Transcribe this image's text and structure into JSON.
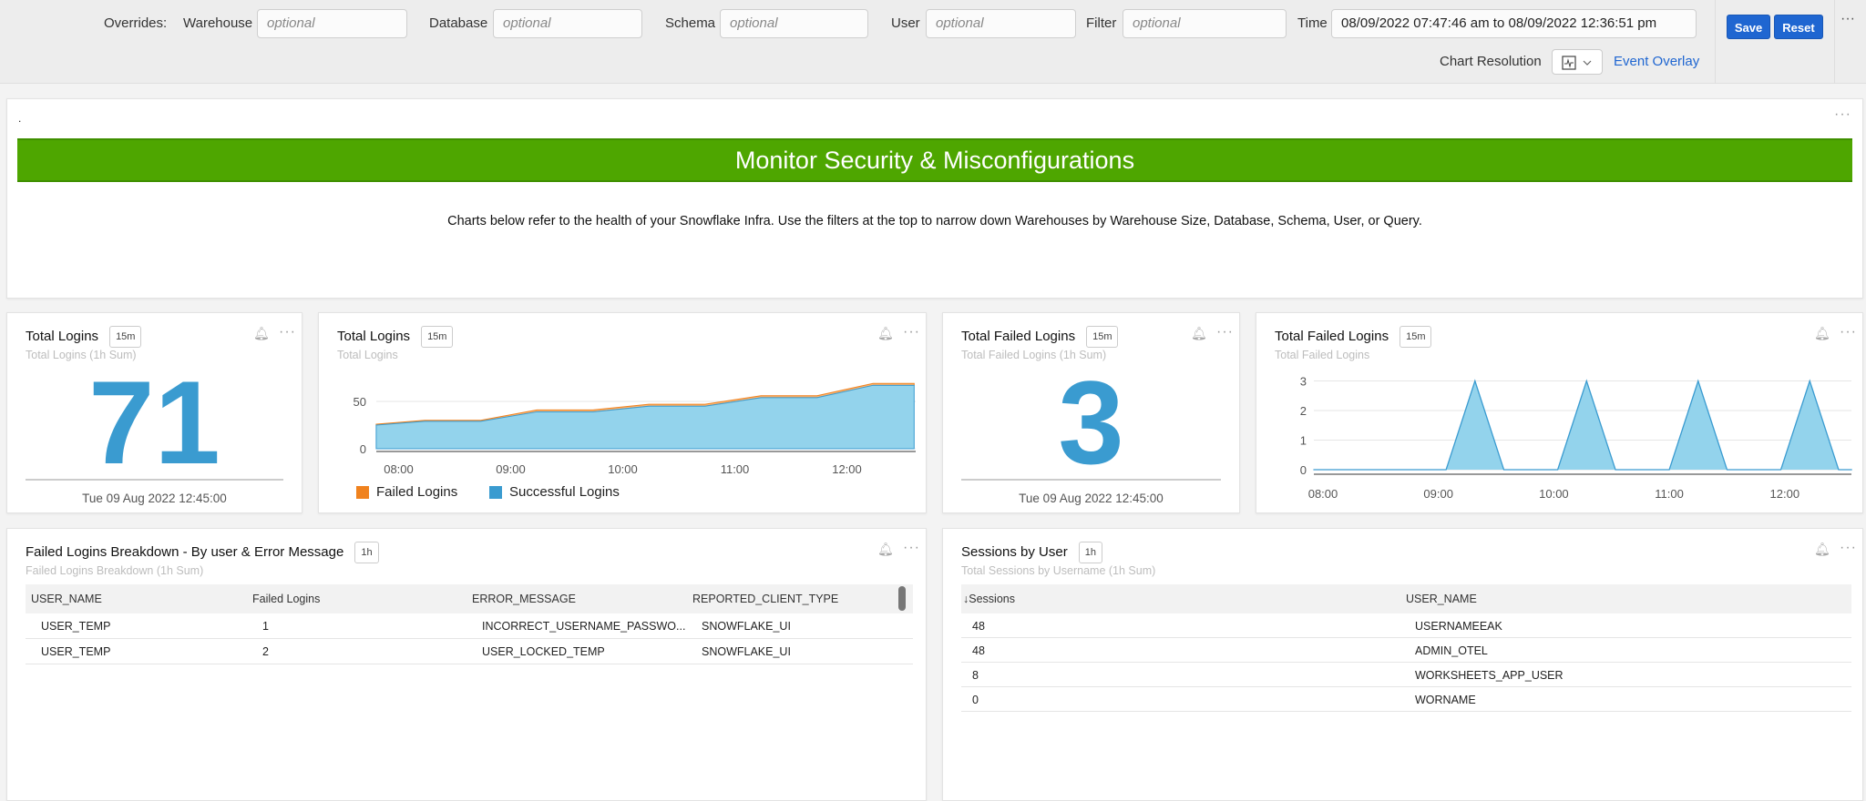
{
  "overrides": {
    "label": "Overrides:",
    "fields": [
      {
        "label": "Warehouse",
        "placeholder": "optional"
      },
      {
        "label": "Database",
        "placeholder": "optional"
      },
      {
        "label": "Schema",
        "placeholder": "optional"
      },
      {
        "label": "User",
        "placeholder": "optional"
      },
      {
        "label": "Filter",
        "placeholder": "optional"
      }
    ],
    "time_label": "Time",
    "time_value": "08/09/2022 07:47:46 am to 08/09/2022 12:36:51 pm",
    "save_label": "Save",
    "reset_label": "Reset",
    "more_label": "···",
    "chart_resolution_label": "Chart Resolution",
    "event_overlay_label": "Event Overlay"
  },
  "text_panel": {
    "title": ".",
    "banner": "Monitor Security & Misconfigurations",
    "banner_color": "#4ea600",
    "description": "Charts below refer to the health of your Snowflake Infra. Use the filters at the top to narrow down Warehouses by Warehouse Size, Database, Schema, User, or Query."
  },
  "cards": {
    "total_logins_single": {
      "title": "Total Logins",
      "badge": "15m",
      "subtitle": "Total Logins (1h Sum)",
      "value": "71",
      "timestamp": "Tue 09 Aug 2022 12:45:00"
    },
    "total_logins_chart": {
      "title": "Total Logins",
      "badge": "15m",
      "subtitle": "Total Logins"
    },
    "failed_logins_single": {
      "title": "Total Failed Logins",
      "badge": "15m",
      "subtitle": "Total Failed Logins (1h Sum)",
      "value": "3",
      "timestamp": "Tue 09 Aug 2022 12:45:00"
    },
    "failed_logins_chart": {
      "title": "Total Failed Logins",
      "badge": "15m",
      "subtitle": "Total Failed Logins"
    },
    "failed_breakdown": {
      "title": "Failed Logins Breakdown - By user & Error Message",
      "badge": "1h",
      "subtitle": "Failed Logins Breakdown (1h Sum)",
      "columns": [
        "USER_NAME",
        "Failed Logins",
        "ERROR_MESSAGE",
        "REPORTED_CLIENT_TYPE"
      ],
      "rows": [
        [
          "USER_TEMP",
          "1",
          "INCORRECT_USERNAME_PASSWO...",
          "SNOWFLAKE_UI"
        ],
        [
          "USER_TEMP",
          "2",
          "USER_LOCKED_TEMP",
          "SNOWFLAKE_UI"
        ]
      ]
    },
    "sessions_by_user": {
      "title": "Sessions by User",
      "badge": "1h",
      "subtitle": "Total Sessions by Username (1h Sum)",
      "columns": [
        "↓Sessions",
        "USER_NAME"
      ],
      "rows": [
        [
          "48",
          "USERNAMEEAK"
        ],
        [
          "48",
          "ADMIN_OTEL"
        ],
        [
          "8",
          "WORKSHEETS_APP_USER"
        ],
        [
          "0",
          "WORNAME"
        ]
      ]
    }
  },
  "chart_data": [
    {
      "type": "area",
      "stacked": true,
      "x": [
        "07:48",
        "08:14",
        "08:44",
        "09:14",
        "09:44",
        "10:14",
        "10:44",
        "11:14",
        "11:44",
        "12:14",
        "12:36"
      ],
      "series": [
        {
          "name": "Successful Logins",
          "color": "#3a9bd0",
          "values": [
            25,
            29,
            29,
            39,
            39,
            45,
            45,
            54,
            54,
            67,
            67
          ]
        },
        {
          "name": "Failed Logins",
          "color": "#f0821e",
          "values": [
            1,
            1,
            1,
            2,
            2,
            2,
            2,
            2,
            2,
            2,
            2
          ]
        }
      ],
      "xticks": [
        "08:00",
        "09:00",
        "10:00",
        "11:00",
        "12:00"
      ],
      "yticks": [
        "0",
        "50"
      ],
      "ylim": [
        0,
        84
      ],
      "legend": "bottom-left"
    },
    {
      "type": "area",
      "x": [
        "07:55",
        "09:04",
        "09:19",
        "09:34",
        "10:02",
        "10:17",
        "10:32",
        "11:00",
        "11:15",
        "11:30",
        "11:58",
        "12:13",
        "12:28",
        "12:35"
      ],
      "series": [
        {
          "color": "#3a9bd0",
          "values": [
            0,
            0,
            3,
            0,
            0,
            3,
            0,
            0,
            3,
            0,
            0,
            3,
            0,
            0
          ]
        }
      ],
      "xticks": [
        "08:00",
        "09:00",
        "10:00",
        "11:00",
        "12:00"
      ],
      "yticks": [
        "0",
        "1",
        "2",
        "3"
      ],
      "ylim": [
        0,
        3
      ]
    }
  ]
}
